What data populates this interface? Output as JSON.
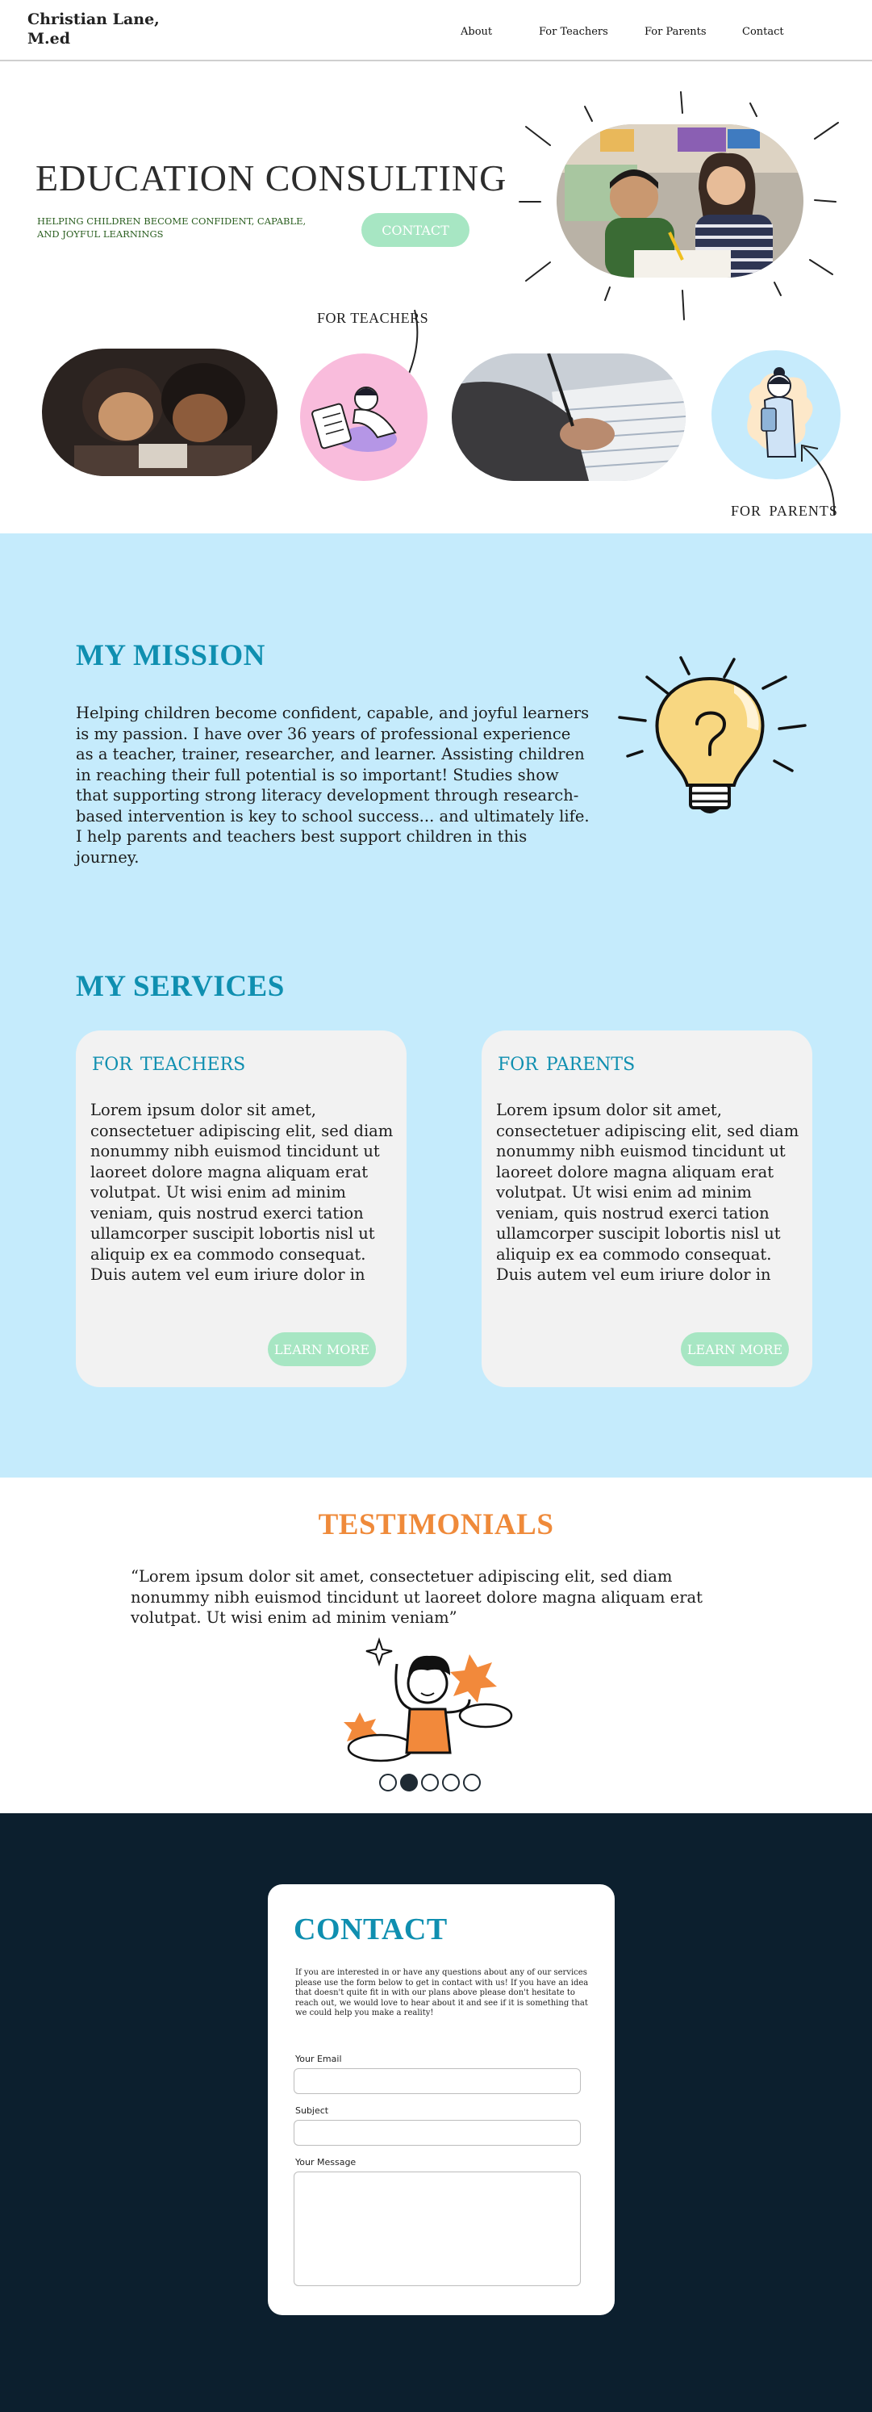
{
  "header": {
    "brand": "Christian Lane, M.ed",
    "nav": [
      "About",
      "For Teachers",
      "For Parents",
      "Contact"
    ]
  },
  "hero": {
    "title": "EDUCATION CONSULTING",
    "subtitle": "HELPING CHILDREN BECOME CONFIDENT, CAPABLE, AND JOYFUL LEARNINGS",
    "button": "CONTACT",
    "label_teachers": "FOR TEACHERS",
    "label_parents": "FOR  PARENTS"
  },
  "mission": {
    "heading": "MY MISSION",
    "text": "Helping children become confident, capable, and joyful learners is my passion. I have over 36 years of professional experience as a teacher, trainer, researcher, and learner. Assisting children in reaching their full potential is so important! Studies show that supporting strong literacy development through research-based intervention is key to school success... and ultimately life. I help parents and teachers best support children in this journey."
  },
  "services": {
    "heading": "MY SERVICES",
    "cards": [
      {
        "title": "FOR TEACHERS",
        "text": "Lorem ipsum dolor sit amet, consectetuer adipiscing elit, sed diam nonummy nibh euismod tincidunt ut laoreet dolore magna aliquam erat volutpat. Ut wisi enim ad minim veniam, quis nostrud exerci tation ullamcorper suscipit lobortis nisl ut aliquip ex ea commodo consequat. Duis autem vel eum iriure dolor in",
        "button": "LEARN MORE"
      },
      {
        "title": "FOR  PARENTS",
        "text": "Lorem ipsum dolor sit amet, consectetuer adipiscing elit, sed diam nonummy nibh euismod tincidunt ut laoreet dolore magna aliquam erat volutpat. Ut wisi enim ad minim veniam, quis nostrud exerci tation ullamcorper suscipit lobortis nisl ut aliquip ex ea commodo consequat. Duis autem vel eum iriure dolor in",
        "button": "LEARN MORE"
      }
    ]
  },
  "testimonials": {
    "heading": "TESTIMONIALS",
    "quote": "“Lorem ipsum dolor sit amet, consectetuer adipiscing elit, sed diam nonummy nibh euismod tincidunt ut laoreet dolore magna aliquam erat volutpat. Ut wisi enim ad minim veniam”",
    "slides": 5,
    "active_slide": 2
  },
  "contact": {
    "heading": "CONTACT",
    "description": "If you are interested in or have any questions about any of our services please use the form below to get in contact with us! If you have an idea that doesn't quite fit in with our plans above please don't hesitate to reach out, we would love to hear about it and see if it is something that we could help you make a reality!",
    "email_label": "Your Email",
    "subject_label": "Subject",
    "message_label": "Your Message"
  },
  "colors": {
    "accent_blue": "#0f8fb0",
    "section_blue": "#c5ebfc",
    "button_green": "#a7e6c3",
    "testimonial_orange": "#ef8a3a",
    "dark_navy": "#0c1f2e",
    "pink_circle": "#f9bcdc"
  }
}
